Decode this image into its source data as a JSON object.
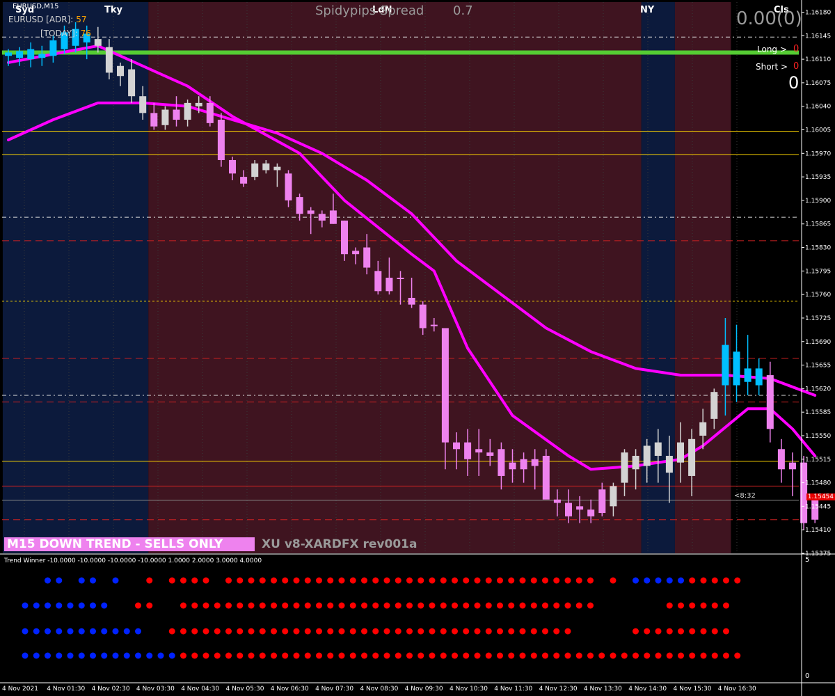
{
  "window": {
    "symbol_label": "EURUSD,M15",
    "indicator_title": "Trend Winner -10.0000 -10.0000 -10.0000 -10.0000 1.0000 2.0000 3.0000 4.0000",
    "adr_label": "EURUSD  [ADR]:",
    "adr_value": "57",
    "today_label": "[TODAY]:",
    "today_value": "76",
    "spread_label": "Spidypips Spread",
    "spread_value": "0.7",
    "sessions": {
      "syd": "Syd",
      "tky": "Tky",
      "ldn": "LdN",
      "ny": "NY",
      "cls": "Cls"
    },
    "pl_value": "0.00(0)",
    "long_label": "Long >",
    "long_value": "0",
    "short_label": "Short >",
    "short_value": "0",
    "total_value": "0",
    "countdown": "<8:32",
    "current_price": "1.15454",
    "trend_banner": "M15  DOWN TREND - SELLS ONLY",
    "version_banner": "XU v8-XARDFX rev001a",
    "subwin_scale_top": "5",
    "subwin_scale_bottom": "0"
  },
  "colors": {
    "bg": "#000000",
    "session_asia": "#0c1a3c",
    "session_london": "#3f1420",
    "bull": "#00bfff",
    "bear": "#ee82ee",
    "neutral": "#d3d3d3",
    "ma_pink": "#ff00ff",
    "ma_blue": "#1a1aff",
    "green_level": "#55cc33",
    "yellow_level": "#ffd700",
    "red_level": "#cc2222",
    "dot_red": "#ff0000",
    "dot_blue": "#0022ff"
  },
  "chart_data": {
    "type": "candlestick",
    "timeframe": "M15",
    "ylim": [
      1.15375,
      1.16195
    ],
    "price_ticks": [
      "1.16180",
      "1.16145",
      "1.16110",
      "1.16075",
      "1.16040",
      "1.16005",
      "1.15970",
      "1.15935",
      "1.15900",
      "1.15865",
      "1.15830",
      "1.15795",
      "1.15760",
      "1.15725",
      "1.15690",
      "1.15655",
      "1.15620",
      "1.15585",
      "1.15550",
      "1.15515",
      "1.15480",
      "1.15445",
      "1.15410",
      "1.15375"
    ],
    "time_ticks": [
      "4 Nov 2021",
      "4 Nov 01:30",
      "4 Nov 02:30",
      "4 Nov 03:30",
      "4 Nov 04:30",
      "4 Nov 05:30",
      "4 Nov 06:30",
      "4 Nov 07:30",
      "4 Nov 08:30",
      "4 Nov 09:30",
      "4 Nov 10:30",
      "4 Nov 11:30",
      "4 Nov 12:30",
      "4 Nov 13:30",
      "4 Nov 14:30",
      "4 Nov 15:30",
      "4 Nov 16:30"
    ],
    "candles": [
      {
        "o": 1.16115,
        "h": 1.16125,
        "l": 1.161,
        "c": 1.1612,
        "t": "b"
      },
      {
        "o": 1.16112,
        "h": 1.16128,
        "l": 1.161,
        "c": 1.16122,
        "t": "b"
      },
      {
        "o": 1.1611,
        "h": 1.16135,
        "l": 1.16098,
        "c": 1.16125,
        "t": "b"
      },
      {
        "o": 1.16112,
        "h": 1.1613,
        "l": 1.161,
        "c": 1.16118,
        "t": "b"
      },
      {
        "o": 1.16115,
        "h": 1.16145,
        "l": 1.16105,
        "c": 1.16138,
        "t": "b"
      },
      {
        "o": 1.16125,
        "h": 1.1616,
        "l": 1.16118,
        "c": 1.1615,
        "t": "b"
      },
      {
        "o": 1.1613,
        "h": 1.16165,
        "l": 1.1612,
        "c": 1.16155,
        "t": "b"
      },
      {
        "o": 1.16135,
        "h": 1.1616,
        "l": 1.1611,
        "c": 1.16148,
        "t": "b"
      },
      {
        "o": 1.1614,
        "h": 1.16158,
        "l": 1.1612,
        "c": 1.1613,
        "t": "n"
      },
      {
        "o": 1.16128,
        "h": 1.1614,
        "l": 1.1608,
        "c": 1.1609,
        "t": "n"
      },
      {
        "o": 1.16085,
        "h": 1.16105,
        "l": 1.1607,
        "c": 1.161,
        "t": "n"
      },
      {
        "o": 1.16095,
        "h": 1.1611,
        "l": 1.16045,
        "c": 1.16055,
        "t": "n"
      },
      {
        "o": 1.16055,
        "h": 1.1607,
        "l": 1.1602,
        "c": 1.1603,
        "t": "n"
      },
      {
        "o": 1.1603,
        "h": 1.16045,
        "l": 1.16005,
        "c": 1.1601,
        "t": "p"
      },
      {
        "o": 1.16012,
        "h": 1.1604,
        "l": 1.16005,
        "c": 1.16035,
        "t": "n"
      },
      {
        "o": 1.16035,
        "h": 1.16055,
        "l": 1.1601,
        "c": 1.1602,
        "t": "p"
      },
      {
        "o": 1.1602,
        "h": 1.1605,
        "l": 1.1601,
        "c": 1.16045,
        "t": "n"
      },
      {
        "o": 1.16045,
        "h": 1.16055,
        "l": 1.1603,
        "c": 1.1604,
        "t": "n"
      },
      {
        "o": 1.16045,
        "h": 1.16055,
        "l": 1.1601,
        "c": 1.16015,
        "t": "p"
      },
      {
        "o": 1.1602,
        "h": 1.1603,
        "l": 1.1595,
        "c": 1.1596,
        "t": "p"
      },
      {
        "o": 1.1596,
        "h": 1.15965,
        "l": 1.1593,
        "c": 1.1594,
        "t": "p"
      },
      {
        "o": 1.15935,
        "h": 1.15945,
        "l": 1.1592,
        "c": 1.15925,
        "t": "p"
      },
      {
        "o": 1.15935,
        "h": 1.1596,
        "l": 1.1593,
        "c": 1.15955,
        "t": "n"
      },
      {
        "o": 1.15955,
        "h": 1.1596,
        "l": 1.1594,
        "c": 1.15945,
        "t": "n"
      },
      {
        "o": 1.15945,
        "h": 1.15955,
        "l": 1.1592,
        "c": 1.1595,
        "t": "n"
      },
      {
        "o": 1.1594,
        "h": 1.15945,
        "l": 1.1589,
        "c": 1.159,
        "t": "p"
      },
      {
        "o": 1.15905,
        "h": 1.1591,
        "l": 1.1587,
        "c": 1.1588,
        "t": "p"
      },
      {
        "o": 1.1588,
        "h": 1.1589,
        "l": 1.1585,
        "c": 1.15885,
        "t": "p"
      },
      {
        "o": 1.1587,
        "h": 1.15885,
        "l": 1.1586,
        "c": 1.1588,
        "t": "p"
      },
      {
        "o": 1.15885,
        "h": 1.1591,
        "l": 1.15865,
        "c": 1.15865,
        "t": "p"
      },
      {
        "o": 1.1587,
        "h": 1.1587,
        "l": 1.1581,
        "c": 1.1582,
        "t": "p"
      },
      {
        "o": 1.15825,
        "h": 1.1583,
        "l": 1.15805,
        "c": 1.1582,
        "t": "p"
      },
      {
        "o": 1.1583,
        "h": 1.1585,
        "l": 1.1579,
        "c": 1.158,
        "t": "p"
      },
      {
        "o": 1.15795,
        "h": 1.1581,
        "l": 1.1576,
        "c": 1.15765,
        "t": "p"
      },
      {
        "o": 1.15785,
        "h": 1.15815,
        "l": 1.1576,
        "c": 1.15765,
        "t": "p"
      },
      {
        "o": 1.15785,
        "h": 1.15795,
        "l": 1.15745,
        "c": 1.15785,
        "t": "p"
      },
      {
        "o": 1.15755,
        "h": 1.15785,
        "l": 1.1574,
        "c": 1.15745,
        "t": "p"
      },
      {
        "o": 1.15745,
        "h": 1.1575,
        "l": 1.157,
        "c": 1.1571,
        "t": "p"
      },
      {
        "o": 1.15715,
        "h": 1.15725,
        "l": 1.15705,
        "c": 1.15715,
        "t": "p"
      },
      {
        "o": 1.1571,
        "h": 1.1571,
        "l": 1.155,
        "c": 1.1554,
        "t": "p"
      },
      {
        "o": 1.1554,
        "h": 1.15555,
        "l": 1.155,
        "c": 1.1553,
        "t": "p"
      },
      {
        "o": 1.1554,
        "h": 1.1556,
        "l": 1.1549,
        "c": 1.15515,
        "t": "p"
      },
      {
        "o": 1.1553,
        "h": 1.1556,
        "l": 1.1549,
        "c": 1.15525,
        "t": "p"
      },
      {
        "o": 1.15525,
        "h": 1.15545,
        "l": 1.15505,
        "c": 1.1552,
        "t": "p"
      },
      {
        "o": 1.1553,
        "h": 1.1554,
        "l": 1.1547,
        "c": 1.1549,
        "t": "p"
      },
      {
        "o": 1.1551,
        "h": 1.1553,
        "l": 1.1548,
        "c": 1.155,
        "t": "p"
      },
      {
        "o": 1.15515,
        "h": 1.15525,
        "l": 1.1548,
        "c": 1.155,
        "t": "p"
      },
      {
        "o": 1.15505,
        "h": 1.1553,
        "l": 1.1547,
        "c": 1.15515,
        "t": "p"
      },
      {
        "o": 1.1552,
        "h": 1.1553,
        "l": 1.1546,
        "c": 1.15455,
        "t": "p"
      },
      {
        "o": 1.15455,
        "h": 1.1547,
        "l": 1.1543,
        "c": 1.1545,
        "t": "p"
      },
      {
        "o": 1.1545,
        "h": 1.1547,
        "l": 1.1542,
        "c": 1.1543,
        "t": "p"
      },
      {
        "o": 1.15445,
        "h": 1.1546,
        "l": 1.1542,
        "c": 1.1544,
        "t": "p"
      },
      {
        "o": 1.1544,
        "h": 1.15455,
        "l": 1.1542,
        "c": 1.1543,
        "t": "p"
      },
      {
        "o": 1.15435,
        "h": 1.1548,
        "l": 1.1543,
        "c": 1.1547,
        "t": "p"
      },
      {
        "o": 1.15445,
        "h": 1.1548,
        "l": 1.1543,
        "c": 1.15475,
        "t": "n"
      },
      {
        "o": 1.1548,
        "h": 1.1553,
        "l": 1.1546,
        "c": 1.15525,
        "t": "n"
      },
      {
        "o": 1.155,
        "h": 1.1553,
        "l": 1.1547,
        "c": 1.1552,
        "t": "n"
      },
      {
        "o": 1.15505,
        "h": 1.15545,
        "l": 1.1548,
        "c": 1.15535,
        "t": "n"
      },
      {
        "o": 1.1552,
        "h": 1.1556,
        "l": 1.1548,
        "c": 1.1554,
        "t": "n"
      },
      {
        "o": 1.15495,
        "h": 1.1555,
        "l": 1.1545,
        "c": 1.1552,
        "t": "n"
      },
      {
        "o": 1.1551,
        "h": 1.1557,
        "l": 1.1548,
        "c": 1.1554,
        "t": "n"
      },
      {
        "o": 1.1549,
        "h": 1.1556,
        "l": 1.1546,
        "c": 1.15545,
        "t": "n"
      },
      {
        "o": 1.1555,
        "h": 1.1559,
        "l": 1.1553,
        "c": 1.1557,
        "t": "n"
      },
      {
        "o": 1.15575,
        "h": 1.1562,
        "l": 1.1556,
        "c": 1.15615,
        "t": "n"
      },
      {
        "o": 1.15625,
        "h": 1.15725,
        "l": 1.1558,
        "c": 1.15685,
        "t": "b"
      },
      {
        "o": 1.15625,
        "h": 1.15715,
        "l": 1.156,
        "c": 1.15675,
        "t": "b"
      },
      {
        "o": 1.1563,
        "h": 1.157,
        "l": 1.1561,
        "c": 1.1565,
        "t": "b"
      },
      {
        "o": 1.15625,
        "h": 1.15665,
        "l": 1.1561,
        "c": 1.1565,
        "t": "b"
      },
      {
        "o": 1.1564,
        "h": 1.1566,
        "l": 1.1554,
        "c": 1.1556,
        "t": "p"
      },
      {
        "o": 1.1553,
        "h": 1.15545,
        "l": 1.1548,
        "c": 1.155,
        "t": "p"
      },
      {
        "o": 1.155,
        "h": 1.15525,
        "l": 1.1546,
        "c": 1.1551,
        "t": "p"
      },
      {
        "o": 1.1551,
        "h": 1.1552,
        "l": 1.1541,
        "c": 1.1542,
        "t": "p"
      },
      {
        "o": 1.15455,
        "h": 1.1546,
        "l": 1.1542,
        "c": 1.15425,
        "t": "p"
      }
    ],
    "ma_fast": [
      [
        0,
        1.16105
      ],
      [
        8,
        1.1613
      ],
      [
        12,
        1.161
      ],
      [
        16,
        1.1607
      ],
      [
        20,
        1.16025
      ],
      [
        26,
        1.1597
      ],
      [
        30,
        1.159
      ],
      [
        36,
        1.1582
      ],
      [
        38,
        1.15795
      ],
      [
        41,
        1.1568
      ],
      [
        45,
        1.1558
      ],
      [
        50,
        1.1552
      ],
      [
        52,
        1.155
      ],
      [
        56,
        1.15505
      ],
      [
        60,
        1.15515
      ],
      [
        62,
        1.15535
      ],
      [
        66,
        1.1559
      ],
      [
        68,
        1.1559
      ],
      [
        70,
        1.1556
      ],
      [
        72,
        1.1552
      ]
    ],
    "ma_slow": [
      [
        0,
        1.1599
      ],
      [
        4,
        1.1602
      ],
      [
        8,
        1.16045
      ],
      [
        12,
        1.16045
      ],
      [
        16,
        1.1604
      ],
      [
        20,
        1.1602
      ],
      [
        24,
        1.16
      ],
      [
        28,
        1.1597
      ],
      [
        32,
        1.1593
      ],
      [
        36,
        1.1588
      ],
      [
        40,
        1.1581
      ],
      [
        44,
        1.1576
      ],
      [
        48,
        1.1571
      ],
      [
        52,
        1.15675
      ],
      [
        56,
        1.1565
      ],
      [
        60,
        1.1564
      ],
      [
        64,
        1.1564
      ],
      [
        68,
        1.15635
      ],
      [
        72,
        1.1561
      ]
    ],
    "levels": [
      {
        "price": 1.1612,
        "style": "green"
      },
      {
        "price": 1.16003,
        "style": "yellow"
      },
      {
        "price": 1.15968,
        "style": "yellow"
      },
      {
        "price": 1.15512,
        "style": "yellow"
      },
      {
        "price": 1.15475,
        "style": "red"
      },
      {
        "price": 1.1575,
        "style": "yellow-dash"
      },
      {
        "price": 1.1561,
        "style": "white-dash"
      },
      {
        "price": 1.15875,
        "style": "white-dash"
      },
      {
        "price": 1.16143,
        "style": "white-dash"
      },
      {
        "price": 1.15665,
        "style": "red-dash"
      },
      {
        "price": 1.1584,
        "style": "red-dash"
      },
      {
        "price": 1.156,
        "style": "red-dash"
      },
      {
        "price": 1.15425,
        "style": "red-dash"
      }
    ],
    "sessions": [
      {
        "name": "asia",
        "start": 0,
        "end": 13
      },
      {
        "name": "london",
        "start": 13,
        "end": 57
      },
      {
        "name": "ny",
        "start": 57,
        "end": 60
      },
      {
        "name": "london",
        "start": 60,
        "end": 65
      }
    ],
    "trend_rows": [
      "..bb.bb.b..r.rrrr.rrrrrrrrrrrrrrrrrrrrrrrrrrrrrrrrr.r.bbbbbrrrrr",
      "bbbbbbbb..rr..rrrrrrrrrrrrrrrrrrrrrrrrrrrrrrrrrrrrr......rrrrrr",
      "bbbbbbbbbbb..rrrrrrrrrrrrrrrrrrrrrrrrrrrrrrrrrrrr.....rrrrrrrrr",
      "bbbbbbbbbbbbbbrrrrrrrrrrrrrrrrrrrrrrrrrrrrrrrrrrrrrrrrrrrrrrrrrr"
    ]
  }
}
